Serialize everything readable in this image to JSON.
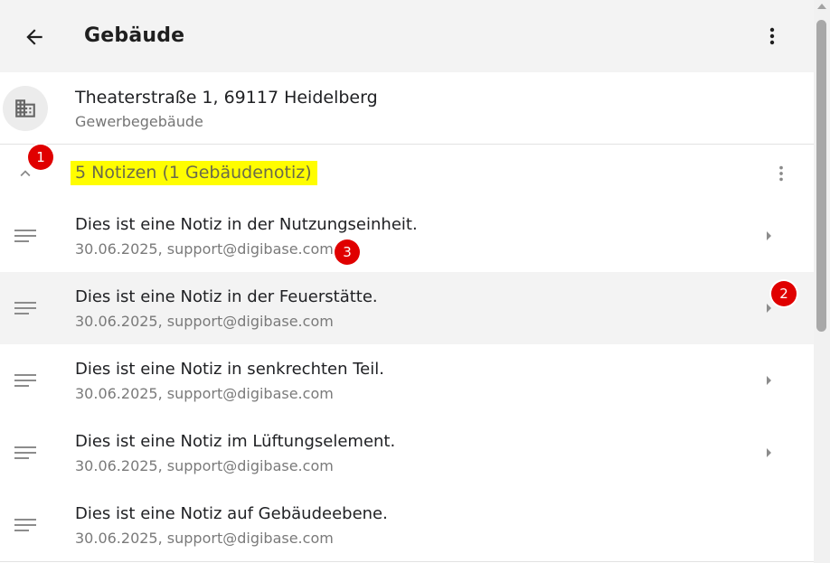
{
  "header": {
    "title": "Gebäude",
    "back_icon": "arrow-left-icon",
    "menu_icon": "more-vertical-icon"
  },
  "building": {
    "icon": "building-icon",
    "address": "Theaterstraße 1, 69117 Heidelberg",
    "type": "Gewerbegebäude"
  },
  "notes_section": {
    "label": "5 Notizen (1 Gebäudenotiz)",
    "highlight_color": "#fffd00",
    "collapse_icon": "chevron-up-icon",
    "menu_icon": "more-vertical-icon"
  },
  "notes": [
    {
      "title": "Dies ist eine Notiz in der Nutzungseinheit.",
      "meta": "30.06.2025, support@digibase.com",
      "has_arrow": true,
      "selected": false
    },
    {
      "title": "Dies ist eine Notiz in der Feuerstätte.",
      "meta": "30.06.2025, support@digibase.com",
      "has_arrow": true,
      "selected": true
    },
    {
      "title": "Dies ist eine Notiz in senkrechten Teil.",
      "meta": "30.06.2025, support@digibase.com",
      "has_arrow": true,
      "selected": false
    },
    {
      "title": "Dies ist eine Notiz im Lüftungselement.",
      "meta": "30.06.2025, support@digibase.com",
      "has_arrow": true,
      "selected": false
    },
    {
      "title": "Dies ist eine Notiz auf Gebäudeebene.",
      "meta": "30.06.2025, support@digibase.com",
      "has_arrow": false,
      "selected": false
    }
  ],
  "annotations": {
    "marker_1": "1",
    "marker_2": "2",
    "marker_3": "3",
    "marker_color": "#e00000"
  }
}
